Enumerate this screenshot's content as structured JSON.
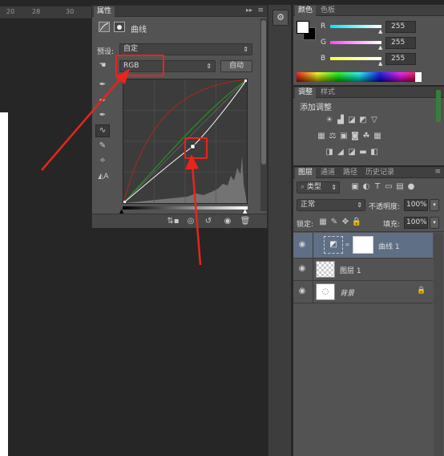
{
  "ruler": {
    "ticks": [
      "20",
      "28",
      "30"
    ]
  },
  "properties": {
    "tabs": [
      "属性"
    ],
    "title": "曲线",
    "preset_label": "预设:",
    "preset_value": "自定",
    "channel_value": "RGB",
    "auto_label": "自动",
    "icons": [
      "hand-adjust-icon",
      "eyedropper-black-icon",
      "eyedropper-gray-icon",
      "eyedropper-white-icon",
      "curve-edit-icon",
      "pencil-icon",
      "smooth-icon",
      "clipping-warning-icon"
    ],
    "bottom_icons": [
      "clip-to-layer-icon",
      "view-previous-icon",
      "reset-icon",
      "visibility-icon",
      "delete-icon"
    ]
  },
  "color_panel": {
    "tabs": [
      "颜色",
      "色板"
    ],
    "channels": [
      {
        "label": "R",
        "value": "255",
        "gradient_color": "#00e5ff"
      },
      {
        "label": "G",
        "value": "255",
        "gradient_color": "#ff44ff"
      },
      {
        "label": "B",
        "value": "255",
        "gradient_color": "#ffff33"
      }
    ]
  },
  "adjustments_panel": {
    "tabs": [
      "调整",
      "样式"
    ],
    "heading": "添加调整"
  },
  "layers_panel": {
    "tabs": [
      "图层",
      "通道",
      "路径",
      "历史记录"
    ],
    "filter_label": "类型",
    "blend_mode": "正常",
    "opacity_label": "不透明度:",
    "opacity_value": "100%",
    "lock_label": "锁定:",
    "fill_label": "填充:",
    "fill_value": "100%",
    "layers": [
      {
        "name": "曲线 1",
        "selected": true,
        "type": "adjustment"
      },
      {
        "name": "图层 1",
        "selected": false,
        "type": "pixel"
      },
      {
        "name": "背景",
        "selected": false,
        "type": "background",
        "locked": true
      }
    ]
  },
  "colors": {
    "panel_bg": "#535353",
    "annotation_red": "#e8241d",
    "curve_white": "#ffffff",
    "curve_green": "#1fa31f",
    "curve_red": "#b0261a"
  }
}
